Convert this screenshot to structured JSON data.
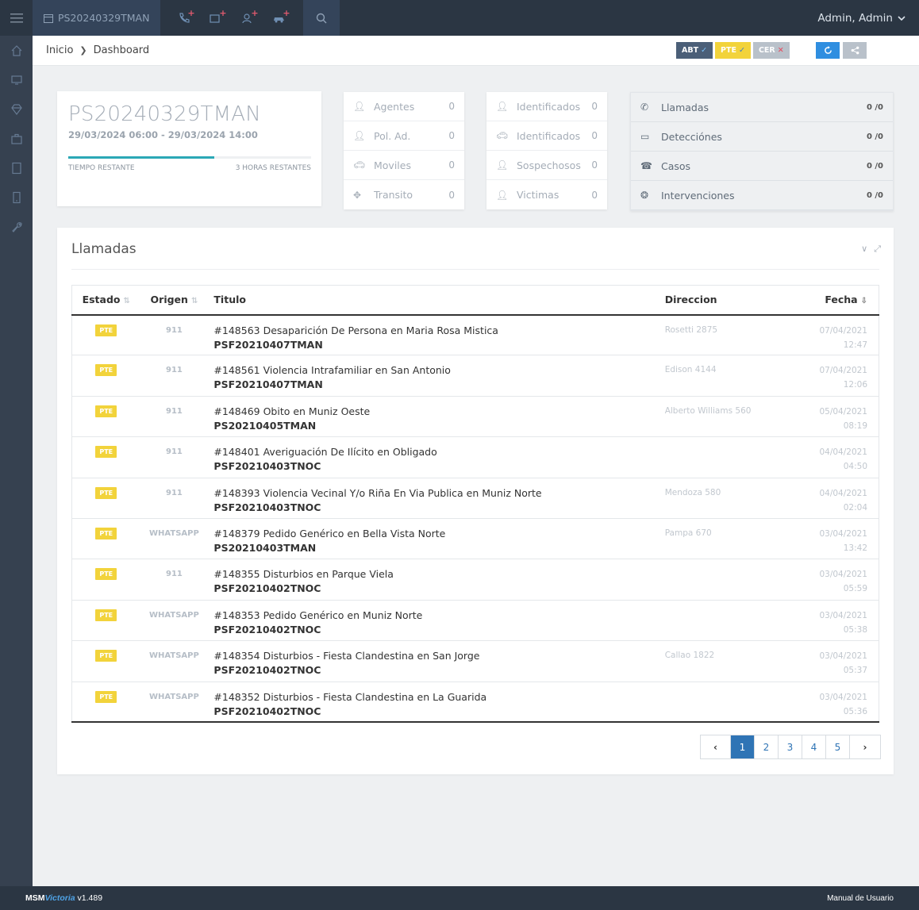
{
  "topbar": {
    "shift_code": "PS20240329TMAN",
    "user_name": "Admin, Admin",
    "icons": [
      "phone-plus-icon",
      "camera-plus-icon",
      "person-plus-icon",
      "car-plus-icon"
    ]
  },
  "sidebar": {
    "items": [
      "home-icon",
      "desktop-icon",
      "diamond-icon",
      "briefcase-icon",
      "tablet-icon",
      "mobile-icon",
      "wrench-icon"
    ]
  },
  "breadcrumb": {
    "home": "Inicio",
    "current": "Dashboard"
  },
  "status_buttons": {
    "abt": "ABT",
    "pte": "PTE",
    "cer": "CER"
  },
  "shift": {
    "title": "PS20240329TMAN",
    "range": "29/03/2024 06:00 - 29/03/2024 14:00",
    "time_left_label": "TIEMPO RESTANTE",
    "time_left_value": "3 HORAS RESTANTES",
    "progress": 0.6
  },
  "stats1": [
    {
      "label": "Agentes",
      "value": "0"
    },
    {
      "label": "Pol. Ad.",
      "value": "0"
    },
    {
      "label": "Moviles",
      "value": "0"
    },
    {
      "label": "Transito",
      "value": "0"
    }
  ],
  "stats2": [
    {
      "label": "Identificados",
      "value": "0"
    },
    {
      "label": "Identificados",
      "value": "0"
    },
    {
      "label": "Sospechosos",
      "value": "0"
    },
    {
      "label": "Victimas",
      "value": "0"
    }
  ],
  "stats3": [
    {
      "label": "Llamadas",
      "value": "0 /0"
    },
    {
      "label": "Detecciónes",
      "value": "0 /0"
    },
    {
      "label": "Casos",
      "value": "0 /0"
    },
    {
      "label": "Intervenciones",
      "value": "0 /0"
    }
  ],
  "panel": {
    "title": "Llamadas",
    "columns": {
      "estado": "Estado",
      "origen": "Origen",
      "titulo": "Titulo",
      "direccion": "Direccion",
      "fecha": "Fecha"
    },
    "rows": [
      {
        "estado": "PTE",
        "origen": "911",
        "titulo": "#148563 Desaparición De Persona en Maria Rosa Mistica",
        "turno": "PSF20210407TMAN",
        "direccion": "Rosetti 2875",
        "fecha": "07/04/2021",
        "hora": "12:47"
      },
      {
        "estado": "PTE",
        "origen": "911",
        "titulo": "#148561 Violencia Intrafamiliar en San Antonio",
        "turno": "PSF20210407TMAN",
        "direccion": "Edison 4144",
        "fecha": "07/04/2021",
        "hora": "12:06"
      },
      {
        "estado": "PTE",
        "origen": "911",
        "titulo": "#148469 Obito en Muniz Oeste",
        "turno": "PS20210405TMAN",
        "direccion": "Alberto Williams 560",
        "fecha": "05/04/2021",
        "hora": "08:19"
      },
      {
        "estado": "PTE",
        "origen": "911",
        "titulo": "#148401 Averiguación De Ilícito en Obligado",
        "turno": "PSF20210403TNOC",
        "direccion": "",
        "fecha": "04/04/2021",
        "hora": "04:50"
      },
      {
        "estado": "PTE",
        "origen": "911",
        "titulo": "#148393 Violencia Vecinal Y/o Riña En Via Publica en Muniz Norte",
        "turno": "PSF20210403TNOC",
        "direccion": "Mendoza 580",
        "fecha": "04/04/2021",
        "hora": "02:04"
      },
      {
        "estado": "PTE",
        "origen": "WHATSAPP",
        "titulo": "#148379 Pedido Genérico en Bella Vista Norte",
        "turno": "PS20210403TMAN",
        "direccion": "Pampa 670",
        "fecha": "03/04/2021",
        "hora": "13:42"
      },
      {
        "estado": "PTE",
        "origen": "911",
        "titulo": "#148355 Disturbios en Parque Viela",
        "turno": "PSF20210402TNOC",
        "direccion": "",
        "fecha": "03/04/2021",
        "hora": "05:59"
      },
      {
        "estado": "PTE",
        "origen": "WHATSAPP",
        "titulo": "#148353 Pedido Genérico en Muniz Norte",
        "turno": "PSF20210402TNOC",
        "direccion": "",
        "fecha": "03/04/2021",
        "hora": "05:38"
      },
      {
        "estado": "PTE",
        "origen": "WHATSAPP",
        "titulo": "#148354 Disturbios - Fiesta Clandestina en San Jorge",
        "turno": "PSF20210402TNOC",
        "direccion": "Callao 1822",
        "fecha": "03/04/2021",
        "hora": "05:37"
      },
      {
        "estado": "PTE",
        "origen": "WHATSAPP",
        "titulo": "#148352 Disturbios - Fiesta Clandestina en La Guarida",
        "turno": "PSF20210402TNOC",
        "direccion": "",
        "fecha": "03/04/2021",
        "hora": "05:36"
      }
    ]
  },
  "pagination": {
    "pages": [
      "1",
      "2",
      "3",
      "4",
      "5"
    ],
    "current": "1"
  },
  "footer": {
    "brand_a": "MSM",
    "brand_b": "Victoria",
    "version": "v1.489",
    "manual": "Manual de Usuario"
  },
  "colors": {
    "topbar": "#2b3643",
    "sidebar": "#364150",
    "accent": "#2f74b5",
    "pte": "#f2d33b",
    "progress": "#2ba8b6"
  }
}
